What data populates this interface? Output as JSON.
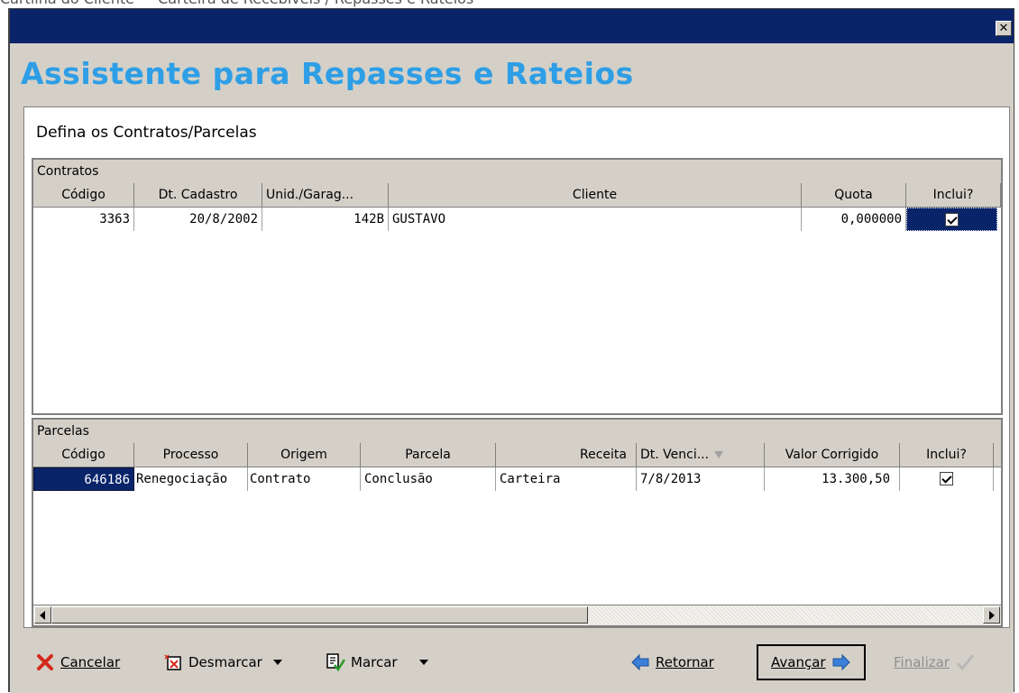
{
  "page_caption": "Cartilha do Cliente — Carteira de Recebíveis / Repasses e Rateios",
  "window": {
    "close_glyph": "✕"
  },
  "wizard": {
    "title": "Assistente para Repasses e Rateios",
    "instruction": "Defina os Contratos/Parcelas"
  },
  "contratos": {
    "caption": "Contratos",
    "columns": [
      "Código",
      "Dt. Cadastro",
      "Unid./Garag...",
      "Cliente",
      "Quota",
      "Inclui?"
    ],
    "rows": [
      {
        "codigo": "3363",
        "dt_cadastro": "20/8/2002",
        "unidade": "142B",
        "cliente": "GUSTAVO",
        "quota": "0,000000",
        "inclui": true
      }
    ]
  },
  "parcelas": {
    "caption": "Parcelas",
    "columns": [
      "Código",
      "Processo",
      "Origem",
      "Parcela",
      "Receita",
      "Dt. Venci...",
      "Valor Corrigido",
      "Inclui?"
    ],
    "rows": [
      {
        "codigo": "646186",
        "processo": "Renegociação",
        "origem": "Contrato",
        "parcela": "Conclusão",
        "receita": "Carteira",
        "dt_venc": "7/8/2013",
        "valor": "13.300,50",
        "inclui": true
      }
    ]
  },
  "toolbar": {
    "cancelar": "Cancelar",
    "desmarcar": "Desmarcar",
    "marcar": "Marcar",
    "retornar": "Retornar",
    "avancar": "Avançar",
    "finalizar": "Finalizar"
  },
  "colors": {
    "title_blue": "#2e9ee6",
    "titlebar": "#0a246a",
    "selection": "#0a246a",
    "chrome": "#d4d0c8"
  },
  "icons": [
    "close-icon",
    "cancel-icon",
    "uncheck-icon",
    "check-list-icon",
    "back-arrow-icon",
    "forward-arrow-icon",
    "finish-check-icon"
  ]
}
